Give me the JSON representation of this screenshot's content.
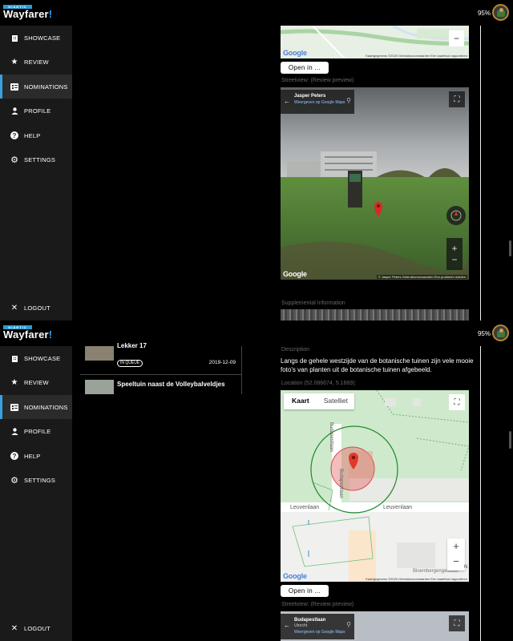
{
  "app": {
    "brand": "NIANTIC",
    "name": "Wayfarer",
    "name_dot": "!"
  },
  "status": {
    "battery": "95%"
  },
  "nav": {
    "items": [
      {
        "label": "SHOWCASE",
        "icon": "building-icon"
      },
      {
        "label": "REVIEW",
        "icon": "star-icon"
      },
      {
        "label": "NOMINATIONS",
        "icon": "list-icon"
      },
      {
        "label": "PROFILE",
        "icon": "person-icon"
      },
      {
        "label": "HELP",
        "icon": "help-icon"
      },
      {
        "label": "SETTINGS",
        "icon": "gear-icon"
      }
    ],
    "logout": "LOGOUT"
  },
  "top_panel": {
    "open_in": "Open in ...",
    "streetview_label": "Streetview: (Review preview)",
    "map_attribution": "Kaartgegevens ©2020   Gebruiksvoorwaarden   Een kaartfout rapporteren",
    "streetview": {
      "author": "Jasper Peters",
      "link": "Weergeven op Google Maps",
      "attribution": "© Jasper Peters   Gebruiksvoorwaarden   Een probleem melden"
    },
    "supplemental_label": "Supplemental Information"
  },
  "bottom_panel": {
    "list": [
      {
        "title": "Lekker 17",
        "status": "IN QUEUE",
        "date": "2019-12-09"
      },
      {
        "title": "Speeltuin naast de Volleybalveldjes",
        "status": "",
        "date": ""
      }
    ],
    "description_label": "Description",
    "description": "Langs de gehele westzijde van de botanische tuinen zijn vele mooie foto's van planten uit de botanische tuinen afgebeeld.",
    "location_label": "Location (52.086674, 5.1669):",
    "map_tabs": {
      "map": "Kaart",
      "satellite": "Satelliet"
    },
    "streets": {
      "street1": "Leuvenlaan",
      "street2": "Leuvenlaan",
      "street3": "Budapestlaan",
      "street4": "Budapestlaan",
      "poi": "Bloembergengebouw"
    },
    "map_attribution": "Kaartgegevens ©2020   Gebruiksvoorwaarden   Een kaartfout rapporteren",
    "open_in": "Open in ...",
    "streetview_label": "Streetview: (Review preview)",
    "streetview": {
      "place": "Budapestlaan",
      "city": "Utrecht",
      "link": "Weergeven op Google Maps"
    },
    "zoom_in": "+",
    "zoom_out": "−",
    "compass_n": "N"
  },
  "colors": {
    "accent": "#3aa0e0",
    "sidebar": "#1a1a1a",
    "map_green": "#c9e8c7"
  }
}
